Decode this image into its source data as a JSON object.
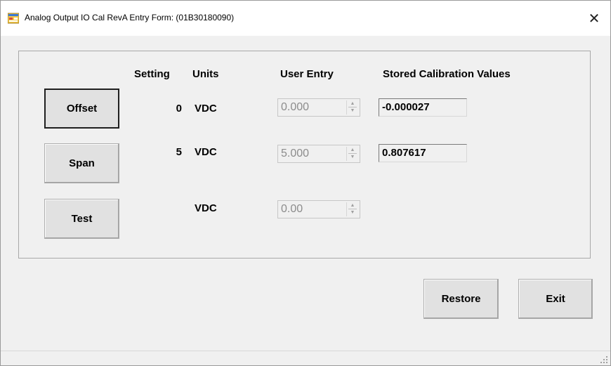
{
  "window": {
    "title": "Analog Output IO Cal RevA Entry Form: (01B30180090)",
    "close_glyph": "✕",
    "icon": "window-app-icon"
  },
  "headers": {
    "setting": "Setting",
    "units": "Units",
    "user_entry": "User Entry",
    "stored": "Stored Calibration Values"
  },
  "rows": [
    {
      "button": "Offset",
      "setting": "0",
      "units": "VDC",
      "user_entry": "0.000",
      "stored": "-0.000027"
    },
    {
      "button": "Span",
      "setting": "5",
      "units": "VDC",
      "user_entry": "5.000",
      "stored": "0.807617"
    },
    {
      "button": "Test",
      "setting": "",
      "units": "VDC",
      "user_entry": "0.00",
      "stored": ""
    }
  ],
  "footer": {
    "restore": "Restore",
    "exit": "Exit"
  },
  "colors": {
    "background": "#f0f0f0",
    "titlebar": "#ffffff",
    "disabled_text": "#8c8c8c"
  }
}
